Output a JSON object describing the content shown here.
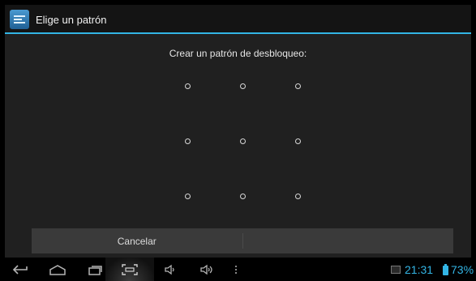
{
  "action_bar": {
    "title": "Elige un patrón",
    "icon": "settings-unlock-icon",
    "accent_color": "#33b5e5"
  },
  "pattern": {
    "header": "Crear un patrón de desbloqueo:",
    "rows": 3,
    "cols": 3
  },
  "buttons": {
    "cancel": "Cancelar",
    "continue": ""
  },
  "status": {
    "time": "21:31",
    "battery": "73%"
  },
  "navbar_icons": [
    "back-icon",
    "home-icon",
    "recent-apps-icon",
    "screenshot-icon",
    "volume-down-icon",
    "volume-up-icon",
    "menu-icon"
  ]
}
